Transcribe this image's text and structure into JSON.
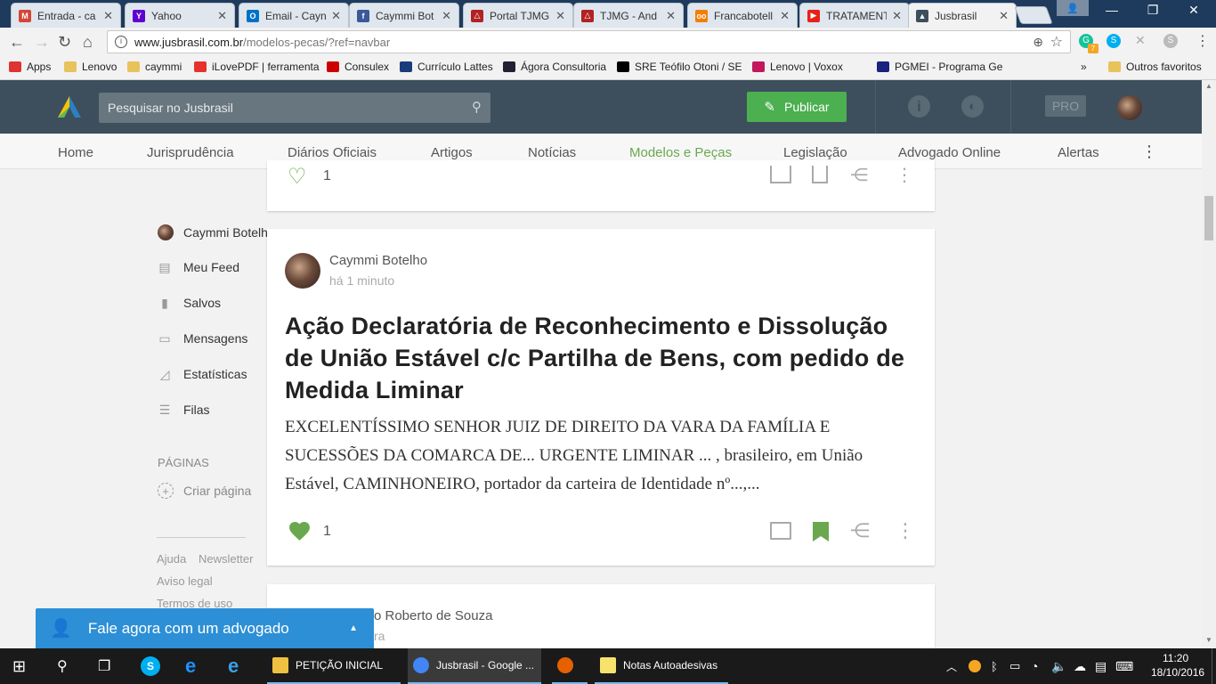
{
  "browser": {
    "tabs": [
      {
        "title": "Entrada - ca",
        "favicon": "gmail-icon",
        "color": "#d44638",
        "glyph": "M"
      },
      {
        "title": "Yahoo",
        "favicon": "yahoo-icon",
        "color": "#5f01d1",
        "glyph": "Y"
      },
      {
        "title": "Email - Cayn",
        "favicon": "outlook-icon",
        "color": "#0072c6",
        "glyph": "O"
      },
      {
        "title": "Caymmi Bot",
        "favicon": "facebook-icon",
        "color": "#3b5998",
        "glyph": "f"
      },
      {
        "title": "Portal TJMG",
        "favicon": "tjmg-icon",
        "color": "#b22222",
        "glyph": "△"
      },
      {
        "title": "TJMG - And",
        "favicon": "tjmg-icon",
        "color": "#b22222",
        "glyph": "△"
      },
      {
        "title": "Francabotell",
        "favicon": "blogger-icon",
        "color": "#f57d00",
        "glyph": "oo"
      },
      {
        "title": "TRATAMENT",
        "favicon": "youtube-icon",
        "color": "#e62117",
        "glyph": "▶"
      },
      {
        "title": "Jusbrasil",
        "favicon": "jusbrasil-icon",
        "color": "#3d4f5c",
        "glyph": "▲"
      }
    ],
    "url_host": "www.jusbrasil.com.br",
    "url_path": "/modelos-pecas/?ref=navbar",
    "bookmarks": [
      {
        "label": "Apps",
        "icon": "apps-icon",
        "color": "#d33"
      },
      {
        "label": "Lenovo",
        "icon": "folder-icon",
        "color": "#e8c25a"
      },
      {
        "label": "caymmi",
        "icon": "folder-icon",
        "color": "#e8c25a"
      },
      {
        "label": "iLovePDF | ferramenta",
        "icon": "heart-icon",
        "color": "#e5322d"
      },
      {
        "label": "Consulex",
        "icon": "consulex-icon",
        "color": "#c00"
      },
      {
        "label": "Currículo Lattes",
        "icon": "lattes-icon",
        "color": "#1a3c7a"
      },
      {
        "label": "Ágora Consultoria",
        "icon": "agora-icon",
        "color": "#223"
      },
      {
        "label": "SRE Teófilo Otoni / SE",
        "icon": "sre-icon",
        "color": "#000"
      },
      {
        "label": "Lenovo | Voxox",
        "icon": "voxox-icon",
        "color": "#c2185b"
      },
      {
        "label": "PGMEI - Programa Ge",
        "icon": "pgmei-icon",
        "color": "#1a237e"
      }
    ],
    "other_bookmarks": "Outros favoritos",
    "extension_badge": "7"
  },
  "header": {
    "search_placeholder": "Pesquisar no Jusbrasil",
    "publish_label": "Publicar",
    "pro_label": "PRO"
  },
  "nav": [
    "Home",
    "Jurisprudência",
    "Diários Oficiais",
    "Artigos",
    "Notícias",
    "Modelos e Peças",
    "Legislação",
    "Advogado Online",
    "Alertas"
  ],
  "sidebar": {
    "user_name": "Caymmi Botelho",
    "items": [
      {
        "label": "Meu Feed",
        "icon": "feed-icon"
      },
      {
        "label": "Salvos",
        "icon": "bookmark-icon"
      },
      {
        "label": "Mensagens",
        "icon": "message-icon"
      },
      {
        "label": "Estatísticas",
        "icon": "stats-icon"
      },
      {
        "label": "Filas",
        "icon": "list-icon"
      }
    ],
    "pages_heading": "PÁGINAS",
    "create_page": "Criar página",
    "footer_links": [
      "Ajuda",
      "Newsletter",
      "Aviso legal",
      "Termos de uso"
    ]
  },
  "feed": {
    "card1": {
      "likes": "1"
    },
    "card2": {
      "author": "Caymmi Botelho",
      "time": "há 1 minuto",
      "title": "Ação Declaratória de Reconhecimento e Dissolução de União Estável c/c Partilha de Bens, com pedido de Medida Liminar",
      "excerpt": "EXCELENTÍSSIMO SENHOR JUIZ DE DIREITO DA VARA DA FAMÍLIA E SUCESSÕES DA COMARCA DE... URGENTE LIMINAR ... , brasileiro, em União Estável, CAMINHONEIRO, portador da carteira de Identidade nº...,...",
      "likes": "1"
    },
    "card3": {
      "author_visible": "o Roberto de Souza",
      "time_visible": "ra"
    }
  },
  "chat": {
    "label": "Fale agora com um advogado"
  },
  "taskbar": {
    "apps": [
      {
        "label": "PETIÇÃO INICIAL",
        "icon": "word-doc-icon",
        "color": "#f0c040"
      },
      {
        "label": "Jusbrasil - Google ...",
        "icon": "chrome-icon",
        "color": "#4285f4"
      },
      {
        "label": "",
        "icon": "firefox-icon",
        "color": "#e66000"
      },
      {
        "label": "Notas Autoadesivas",
        "icon": "sticky-notes-icon",
        "color": "#f7e36b"
      }
    ],
    "time": "11:20",
    "date": "18/10/2016"
  },
  "colors": {
    "brand_green": "#6aa84f",
    "header_dark": "#3d4f5c",
    "chat_blue": "#2d8fd5"
  }
}
